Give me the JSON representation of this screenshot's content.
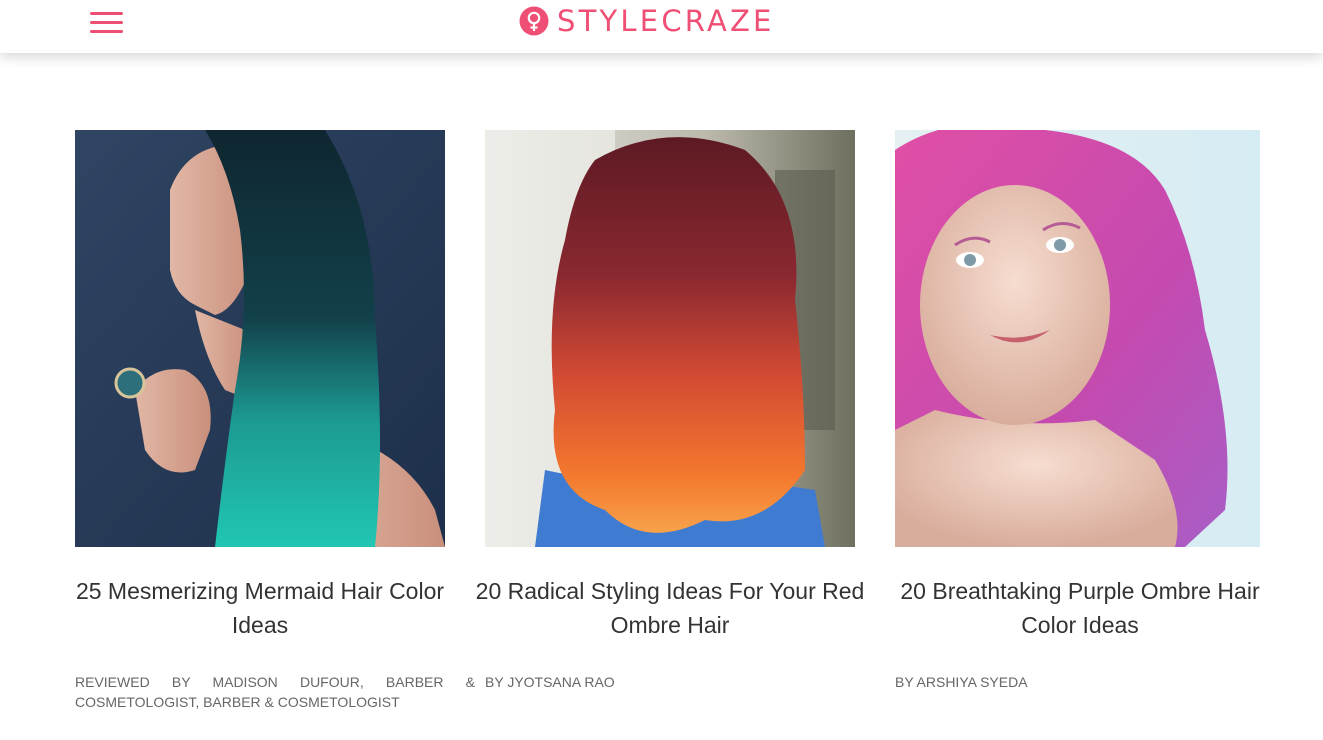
{
  "header": {
    "logo_text": "STYLECRAZE",
    "accent_color": "#ef4f74",
    "menu_icon": "hamburger-menu-icon",
    "logo_icon": "female-symbol-icon"
  },
  "articles": [
    {
      "title": "25 Mesmerizing Mermaid Hair Color Ideas",
      "byline": "REVIEWED BY MADISON DUFOUR, BARBER & COSMETOLOGIST, BARBER & COSMETOLOGIST",
      "image": "Woman with long straight dark hair fading into teal-green mermaid ends"
    },
    {
      "title": "20 Radical Styling Ideas For Your Red Ombre Hair",
      "byline": "BY JYOTSANA RAO",
      "image": "Back view of wavy red hair fading into bright orange ombre ends"
    },
    {
      "title": "20 Breathtaking Purple Ombre Hair Color Ideas",
      "byline": "BY ARSHIYA SYEDA",
      "image": "Portrait of a woman with wavy pink-purple hair"
    }
  ]
}
